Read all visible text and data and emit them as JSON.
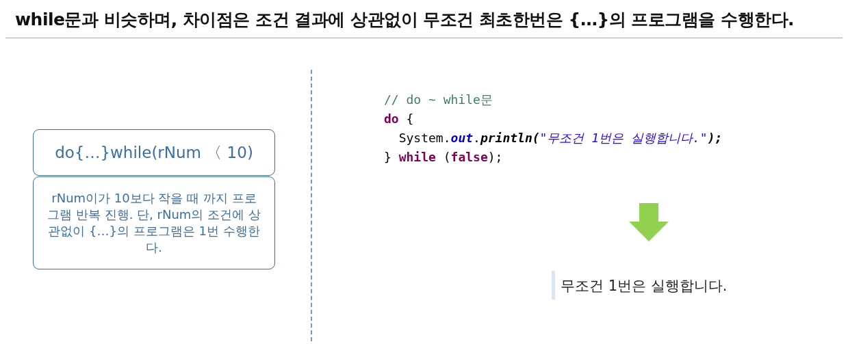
{
  "title": "while문과 비슷하며, 차이점은 조건 결과에 상관없이 무조건 최초한번은 {…}의 프로그램을 수행한다.",
  "syntax_box": {
    "heading": "do{…}while(rNum 〈 10)",
    "description": "rNum이가 10보다 작을 때 까지 프로그램 반복 진행. 단, rNum의 조건에 상관없이 {…}의 프로그램은 1번 수행한다."
  },
  "code": {
    "lines": [
      {
        "tokens": [
          {
            "kind": "comment",
            "text": "// do ~ while문"
          }
        ]
      },
      {
        "tokens": [
          {
            "kind": "keyword",
            "text": "do"
          },
          {
            "kind": "plain",
            "text": " {"
          }
        ]
      },
      {
        "tokens": [
          {
            "kind": "plain",
            "text": "  System."
          },
          {
            "kind": "field",
            "text": "out"
          },
          {
            "kind": "plain",
            "text": "."
          },
          {
            "kind": "method",
            "text": "println("
          },
          {
            "kind": "string",
            "text": "\"무조건 1번은 실행합니다.\""
          },
          {
            "kind": "method",
            "text": ");"
          }
        ]
      },
      {
        "tokens": [
          {
            "kind": "plain",
            "text": "} "
          },
          {
            "kind": "keyword",
            "text": "while"
          },
          {
            "kind": "plain",
            "text": " ("
          },
          {
            "kind": "keyword",
            "text": "false"
          },
          {
            "kind": "plain",
            "text": ");"
          }
        ]
      }
    ]
  },
  "output": {
    "text": "무조건 1번은 실행합니다."
  }
}
